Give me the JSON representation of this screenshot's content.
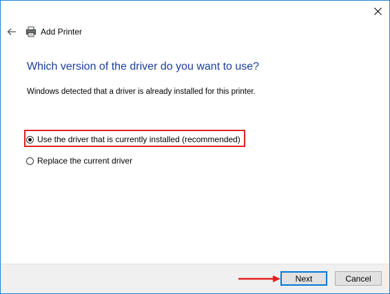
{
  "window": {
    "title": "Add Printer",
    "close_label": "✕",
    "back_label": "←"
  },
  "main": {
    "heading": "Which version of the driver do you want to use?",
    "description": "Windows detected that a driver is already installed for this printer.",
    "options": [
      {
        "label": "Use the driver that is currently installed (recommended)",
        "selected": true
      },
      {
        "label": "Replace the current driver",
        "selected": false
      }
    ]
  },
  "footer": {
    "next_label": "Next",
    "cancel_label": "Cancel"
  },
  "colors": {
    "accent": "#0078d7",
    "heading": "#1a3e9c",
    "annotation": "#e02020"
  },
  "icons": {
    "close": "close-icon",
    "back": "back-arrow-icon",
    "printer": "printer-icon",
    "annotation_arrow": "red-arrow-icon"
  }
}
